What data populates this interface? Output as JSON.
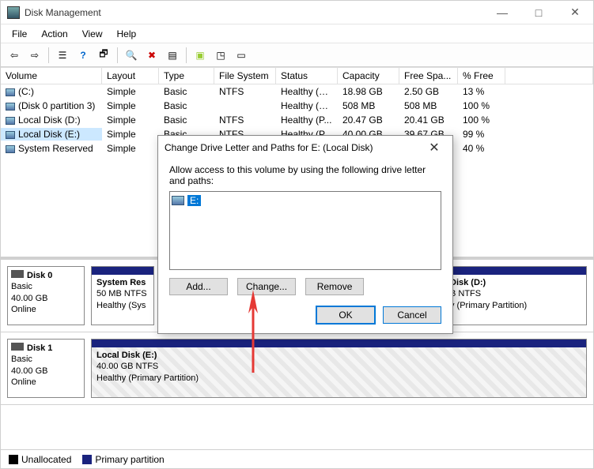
{
  "window": {
    "title": "Disk Management",
    "minimize": "—",
    "maximize": "□",
    "close": "✕"
  },
  "menu": {
    "file": "File",
    "action": "Action",
    "view": "View",
    "help": "Help"
  },
  "columns": {
    "volume": "Volume",
    "layout": "Layout",
    "type": "Type",
    "fs": "File System",
    "status": "Status",
    "capacity": "Capacity",
    "free": "Free Spa...",
    "pct": "% Free"
  },
  "rows": [
    {
      "volume": "(C:)",
      "layout": "Simple",
      "type": "Basic",
      "fs": "NTFS",
      "status": "Healthy (B...",
      "capacity": "18.98 GB",
      "free": "2.50 GB",
      "pct": "13 %"
    },
    {
      "volume": "(Disk 0 partition 3)",
      "layout": "Simple",
      "type": "Basic",
      "fs": "",
      "status": "Healthy (R...",
      "capacity": "508 MB",
      "free": "508 MB",
      "pct": "100 %"
    },
    {
      "volume": "Local Disk (D:)",
      "layout": "Simple",
      "type": "Basic",
      "fs": "NTFS",
      "status": "Healthy (P...",
      "capacity": "20.47 GB",
      "free": "20.41 GB",
      "pct": "100 %"
    },
    {
      "volume": "Local Disk (E:)",
      "layout": "Simple",
      "type": "Basic",
      "fs": "NTFS",
      "status": "Healthy (P...",
      "capacity": "40.00 GB",
      "free": "39.67 GB",
      "pct": "99 %"
    },
    {
      "volume": "System Reserved",
      "layout": "Simple",
      "type": "",
      "fs": "",
      "status": "",
      "capacity": "",
      "free": "B",
      "pct": "40 %"
    }
  ],
  "disks": [
    {
      "name": "Disk 0",
      "type": "Basic",
      "size": "40.00 GB",
      "status": "Online",
      "vols": [
        {
          "label": "System Res",
          "sub": "50 MB NTFS",
          "stat": "Healthy (Sys",
          "hatch": false
        },
        {
          "label": "",
          "sub": "",
          "stat": "",
          "hidden": true
        },
        {
          "label": "Disk  (D:)",
          "sub": "B NTFS",
          "stat": "y (Primary Partition)",
          "hatch": false,
          "right": true
        }
      ]
    },
    {
      "name": "Disk 1",
      "type": "Basic",
      "size": "40.00 GB",
      "status": "Online",
      "vols": [
        {
          "label": "Local Disk  (E:)",
          "sub": "40.00 GB NTFS",
          "stat": "Healthy (Primary Partition)",
          "hatch": true
        }
      ]
    }
  ],
  "legend": {
    "unalloc": "Unallocated",
    "primary": "Primary partition"
  },
  "dialog": {
    "title": "Change Drive Letter and Paths for E: (Local Disk)",
    "text": "Allow access to this volume by using the following drive letter and paths:",
    "item": "E:",
    "add": "Add...",
    "change": "Change...",
    "remove": "Remove",
    "ok": "OK",
    "cancel": "Cancel"
  },
  "colors": {
    "header": "#1a237e",
    "accent": "#0078d7"
  }
}
